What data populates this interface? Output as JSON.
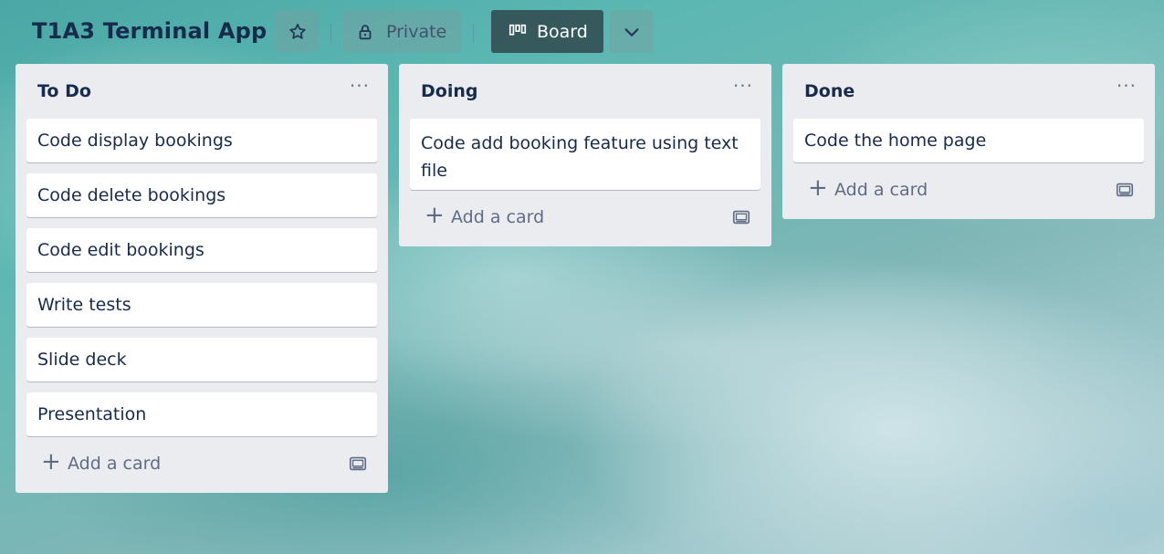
{
  "header": {
    "board_title": "T1A3 Terminal App",
    "star_icon": "star-icon",
    "visibility_label": "Private",
    "visibility_icon": "lock-icon",
    "view_label": "Board",
    "view_icon": "board-columns-icon",
    "switch_icon": "chevron-down-icon"
  },
  "lists": [
    {
      "title": "To Do",
      "menu": "···",
      "cards": [
        "Code display bookings",
        "Code delete bookings",
        "Code edit bookings",
        "Write tests",
        "Slide deck",
        "Presentation"
      ],
      "add_label": "Add a card"
    },
    {
      "title": "Doing",
      "menu": "···",
      "cards": [
        "Code add booking feature using text file"
      ],
      "add_label": "Add a card"
    },
    {
      "title": "Done",
      "menu": "···",
      "cards": [
        "Code the home page"
      ],
      "add_label": "Add a card"
    }
  ],
  "colors": {
    "list_bg": "#ebecf0",
    "title_text": "#172b4d",
    "muted_text": "#5e6c84",
    "board_button_bg": "#3d4a52"
  }
}
